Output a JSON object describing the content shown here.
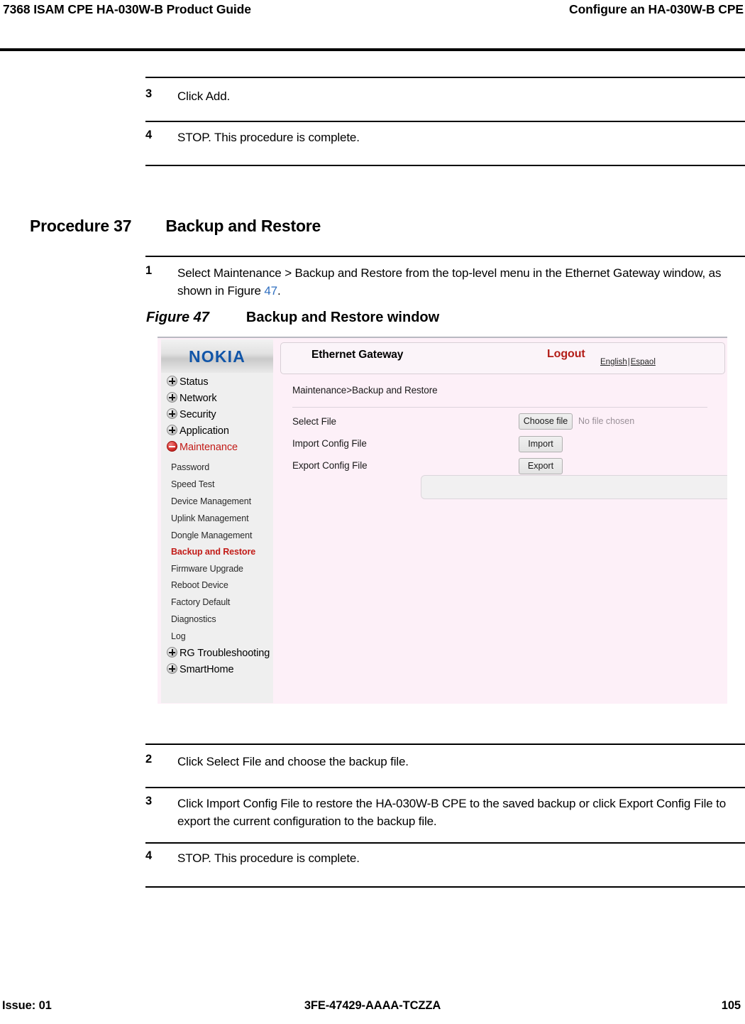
{
  "header": {
    "left": "7368 ISAM CPE HA-030W-B Product Guide",
    "right": "Configure an HA-030W-B CPE"
  },
  "top_steps": [
    {
      "num": "3",
      "text": "Click Add."
    },
    {
      "num": "4",
      "text": "STOP. This procedure is complete."
    }
  ],
  "procedure": {
    "label": "Procedure 37",
    "name": "Backup and Restore"
  },
  "step_one": {
    "num": "1",
    "text_before": "Select Maintenance > Backup and Restore from the top-level menu in the Ethernet Gateway window, as shown in Figure ",
    "xref": "47",
    "text_after": "."
  },
  "figure": {
    "label": "Figure 47",
    "name": "Backup and Restore window"
  },
  "device_ui": {
    "logo": "NOKIA",
    "title": "Ethernet Gateway",
    "logout": "Logout",
    "languages": {
      "first": "English",
      "separator": "|",
      "second": "Espaol"
    },
    "breadcrumb": "Maintenance>Backup and Restore",
    "sidebar_top": [
      {
        "label": "Status",
        "icon": "plus-icon",
        "expanded": false
      },
      {
        "label": "Network",
        "icon": "plus-icon",
        "expanded": false
      },
      {
        "label": "Security",
        "icon": "plus-icon",
        "expanded": false
      },
      {
        "label": "Application",
        "icon": "plus-icon",
        "expanded": false
      },
      {
        "label": "Maintenance",
        "icon": "minus-icon",
        "expanded": true
      }
    ],
    "sidebar_sub": [
      {
        "label": "Password",
        "active": false
      },
      {
        "label": "Speed Test",
        "active": false
      },
      {
        "label": "Device Management",
        "active": false
      },
      {
        "label": "Uplink Management",
        "active": false
      },
      {
        "label": "Dongle Management",
        "active": false
      },
      {
        "label": "Backup and Restore",
        "active": true
      },
      {
        "label": "Firmware Upgrade",
        "active": false
      },
      {
        "label": "Reboot Device",
        "active": false
      },
      {
        "label": "Factory Default",
        "active": false
      },
      {
        "label": "Diagnostics",
        "active": false
      },
      {
        "label": "Log",
        "active": false
      }
    ],
    "sidebar_bottom": [
      {
        "label": "RG Troubleshooting",
        "icon": "plus-icon"
      },
      {
        "label": "SmartHome",
        "icon": "plus-icon"
      }
    ],
    "form": {
      "select_file_label": "Select File",
      "choose_file_button": "Choose file",
      "no_file_chosen": "No file chosen",
      "import_label": "Import Config File",
      "import_button": "Import",
      "export_label": "Export Config File",
      "export_button": "Export",
      "result_value": ""
    },
    "colors": {
      "logo_blue": "#1155a8",
      "accent_red": "#c21b17",
      "panel_pink": "#fdf0f8",
      "sidebar_gray": "#efefef"
    }
  },
  "bottom_steps": [
    {
      "num": "2",
      "text": "Click Select File and choose the backup file."
    },
    {
      "num": "3",
      "text": "Click Import Config File to restore the HA-030W-B CPE to the saved backup or click Export Config File to export the current configuration to the backup file."
    },
    {
      "num": "4",
      "text": "STOP. This procedure is complete."
    }
  ],
  "footer": {
    "issue": "Issue: 01",
    "doc_id": "3FE-47429-AAAA-TCZZA",
    "page": "105"
  }
}
